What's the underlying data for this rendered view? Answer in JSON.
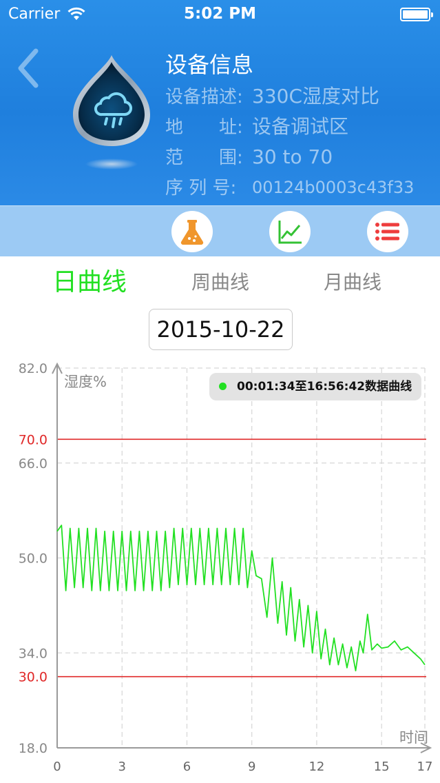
{
  "status_bar": {
    "carrier": "Carrier",
    "time": "5:02 PM"
  },
  "header": {
    "title": "设备信息",
    "fields": [
      {
        "label": "设备描述:",
        "value": "330C湿度对比"
      },
      {
        "label": "地　　址:",
        "value": "设备调试区"
      },
      {
        "label": "范　　围:",
        "value": "30 to 70"
      },
      {
        "label": "序 列 号:",
        "value": "00124b0003c43f33"
      }
    ],
    "icons": {
      "back": "back-chevron-icon",
      "device": "water-drop-cloud-icon"
    }
  },
  "toolbar": {
    "buttons": [
      {
        "icon": "flask-icon",
        "color": "#f0962c"
      },
      {
        "icon": "line-chart-icon",
        "color": "#34c234"
      },
      {
        "icon": "list-icon",
        "color": "#ee3d3d"
      }
    ]
  },
  "tabs": [
    {
      "label": "日曲线",
      "active": true
    },
    {
      "label": "周曲线",
      "active": false
    },
    {
      "label": "月曲线",
      "active": false
    }
  ],
  "date": "2015-10-22",
  "colors": {
    "accent_green": "#22e022",
    "header_blue": "#1f7fdd",
    "threshold_red": "#e02828"
  },
  "chart_data": {
    "type": "line",
    "ylabel": "湿度%",
    "xlabel": "时间",
    "ylim": [
      18,
      82
    ],
    "xlim": [
      0,
      17
    ],
    "yticks": [
      "82.0",
      "66.0",
      "50.0",
      "34.0",
      "18.0"
    ],
    "xticks": [
      "0",
      "3",
      "6",
      "9",
      "12",
      "15",
      "17"
    ],
    "grid": true,
    "thresholds": [
      {
        "label": "70.0",
        "value": 70
      },
      {
        "label": "30.0",
        "value": 30
      }
    ],
    "legend": {
      "position": "top-right",
      "text": "00:01:34至16:56:42数据曲线"
    },
    "series": [
      {
        "color": "#22e022",
        "points": [
          [
            0,
            54.5
          ],
          [
            0.2,
            55.5
          ],
          [
            0.4,
            44.5
          ],
          [
            0.6,
            55
          ],
          [
            0.8,
            45
          ],
          [
            1.0,
            55
          ],
          [
            1.2,
            45
          ],
          [
            1.4,
            55
          ],
          [
            1.6,
            44.5
          ],
          [
            1.8,
            55
          ],
          [
            2.0,
            44.5
          ],
          [
            2.2,
            54.5
          ],
          [
            2.4,
            44.5
          ],
          [
            2.6,
            54.5
          ],
          [
            2.8,
            44.5
          ],
          [
            3.0,
            54.5
          ],
          [
            3.2,
            44.5
          ],
          [
            3.4,
            54.5
          ],
          [
            3.6,
            44.5
          ],
          [
            3.8,
            54.5
          ],
          [
            4.0,
            44.5
          ],
          [
            4.2,
            54.5
          ],
          [
            4.4,
            44.5
          ],
          [
            4.6,
            54.5
          ],
          [
            4.8,
            44.5
          ],
          [
            5.0,
            54.5
          ],
          [
            5.2,
            45
          ],
          [
            5.4,
            55
          ],
          [
            5.6,
            45.5
          ],
          [
            5.8,
            55
          ],
          [
            6.0,
            45.5
          ],
          [
            6.2,
            55
          ],
          [
            6.4,
            45.5
          ],
          [
            6.6,
            55
          ],
          [
            6.8,
            45.5
          ],
          [
            7.0,
            55
          ],
          [
            7.2,
            45.5
          ],
          [
            7.4,
            55
          ],
          [
            7.6,
            45.5
          ],
          [
            7.8,
            55
          ],
          [
            8.0,
            45.5
          ],
          [
            8.2,
            55
          ],
          [
            8.4,
            45.5
          ],
          [
            8.6,
            55
          ],
          [
            8.8,
            45
          ],
          [
            9.0,
            51.2
          ],
          [
            9.2,
            47
          ],
          [
            9.45,
            46.5
          ],
          [
            9.7,
            40
          ],
          [
            9.95,
            50
          ],
          [
            10.2,
            39
          ],
          [
            10.4,
            46
          ],
          [
            10.6,
            37
          ],
          [
            10.8,
            45
          ],
          [
            11.0,
            36
          ],
          [
            11.2,
            43
          ],
          [
            11.4,
            35
          ],
          [
            11.6,
            42
          ],
          [
            11.8,
            34
          ],
          [
            12.0,
            41
          ],
          [
            12.2,
            33
          ],
          [
            12.4,
            38
          ],
          [
            12.6,
            32
          ],
          [
            12.8,
            36.5
          ],
          [
            13.0,
            32
          ],
          [
            13.2,
            35.5
          ],
          [
            13.4,
            31.5
          ],
          [
            13.6,
            35
          ],
          [
            13.8,
            31
          ],
          [
            14.0,
            36
          ],
          [
            14.15,
            34
          ],
          [
            14.35,
            40.5
          ],
          [
            14.55,
            34.5
          ],
          [
            14.8,
            35.5
          ],
          [
            15.0,
            34.8
          ],
          [
            15.3,
            35
          ],
          [
            15.6,
            36
          ],
          [
            15.9,
            34.5
          ],
          [
            16.2,
            35
          ],
          [
            16.5,
            34
          ],
          [
            16.8,
            33
          ],
          [
            17.0,
            32
          ]
        ]
      }
    ]
  }
}
